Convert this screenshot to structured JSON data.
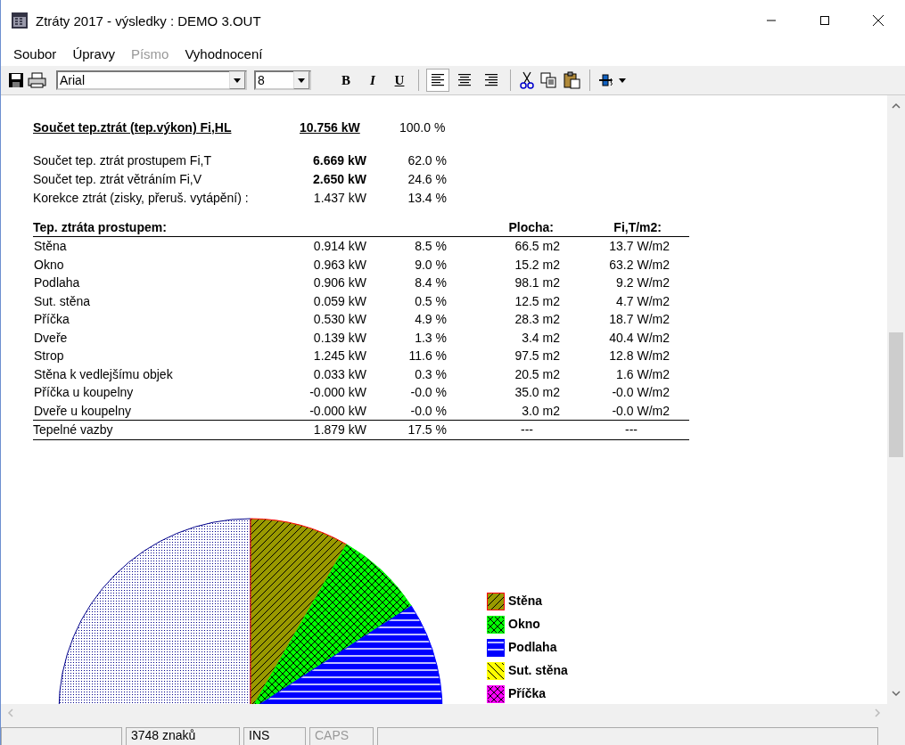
{
  "window": {
    "title": "Ztráty 2017 - výsledky : DEMO 3.OUT"
  },
  "menu": [
    {
      "label": "Soubor",
      "disabled": false
    },
    {
      "label": "Úpravy",
      "disabled": false
    },
    {
      "label": "Písmo",
      "disabled": true
    },
    {
      "label": "Vyhodnocení",
      "disabled": false
    }
  ],
  "toolbar": {
    "font": "Arial",
    "size": "8",
    "styles": [
      {
        "kind": "bold",
        "label": "B"
      },
      {
        "kind": "italic",
        "label": "I"
      },
      {
        "kind": "underline",
        "label": "U"
      }
    ],
    "align": [
      {
        "kind": "left",
        "selected": true
      },
      {
        "kind": "center",
        "selected": false
      },
      {
        "kind": "right",
        "selected": false
      }
    ]
  },
  "summary": {
    "total": {
      "label": "Součet tep.ztrát (tep.výkon) Fi,HL",
      "value": "10.756 kW",
      "percent": "100.0 %"
    },
    "rows": [
      {
        "label": "Součet tep. ztrát prostupem Fi,T",
        "value": "6.669 kW",
        "percent": "62.0 %",
        "bold": true
      },
      {
        "label": "Součet tep. ztrát větráním Fi,V",
        "value": "2.650 kW",
        "percent": "24.6 %",
        "bold": true
      },
      {
        "label": "Korekce ztrát (zisky, přeruš. vytápění) :",
        "value": "1.437 kW",
        "percent": "13.4 %",
        "bold": false
      }
    ]
  },
  "table": {
    "header": {
      "title": "Tep. ztráta prostupem:",
      "area": "Plocha:",
      "per_area": "Fi,T/m2:"
    },
    "rows": [
      {
        "label": "Stěna",
        "power": "0.914 kW",
        "share": "8.5 %",
        "area": "66.5 m2",
        "per_area": "13.7 W/m2"
      },
      {
        "label": "Okno",
        "power": "0.963 kW",
        "share": "9.0 %",
        "area": "15.2 m2",
        "per_area": "63.2 W/m2"
      },
      {
        "label": "Podlaha",
        "power": "0.906 kW",
        "share": "8.4 %",
        "area": "98.1 m2",
        "per_area": "9.2 W/m2"
      },
      {
        "label": "Sut. stěna",
        "power": "0.059 kW",
        "share": "0.5 %",
        "area": "12.5 m2",
        "per_area": "4.7 W/m2"
      },
      {
        "label": "Příčka",
        "power": "0.530 kW",
        "share": "4.9 %",
        "area": "28.3 m2",
        "per_area": "18.7 W/m2"
      },
      {
        "label": "Dveře",
        "power": "0.139 kW",
        "share": "1.3 %",
        "area": "3.4 m2",
        "per_area": "40.4 W/m2"
      },
      {
        "label": "Strop",
        "power": "1.245 kW",
        "share": "11.6 %",
        "area": "97.5 m2",
        "per_area": "12.8 W/m2"
      },
      {
        "label": "Stěna k vedlejšímu objek",
        "power": "0.033 kW",
        "share": "0.3 %",
        "area": "20.5 m2",
        "per_area": "1.6 W/m2"
      },
      {
        "label": "Příčka u koupelny",
        "power": "-0.000 kW",
        "share": "-0.0 %",
        "area": "35.0 m2",
        "per_area": "-0.0 W/m2"
      },
      {
        "label": "Dveře u koupelny",
        "power": "-0.000 kW",
        "share": "-0.0 %",
        "area": "3.0 m2",
        "per_area": "-0.0 W/m2"
      }
    ],
    "footer": {
      "label": "Tepelné vazby",
      "power": "1.879 kW",
      "share": "17.5 %",
      "area": "---",
      "per_area": "---"
    }
  },
  "legend": [
    {
      "label": "Stěna",
      "color": "#999900",
      "kind": "diagonal"
    },
    {
      "label": "Okno",
      "color": "#00ff00",
      "kind": "cross"
    },
    {
      "label": "Podlaha",
      "color": "#0000ff",
      "kind": "horizontal"
    },
    {
      "label": "Sut. stěna",
      "color": "#ffff00",
      "kind": "backdiagonal"
    },
    {
      "label": "Příčka",
      "color": "#ff00ff",
      "kind": "cross"
    }
  ],
  "status_bar": [
    {
      "text": "3748 znaků",
      "disabled": false
    },
    {
      "text": "INS",
      "disabled": false
    },
    {
      "text": "CAPS",
      "disabled": true
    }
  ]
}
